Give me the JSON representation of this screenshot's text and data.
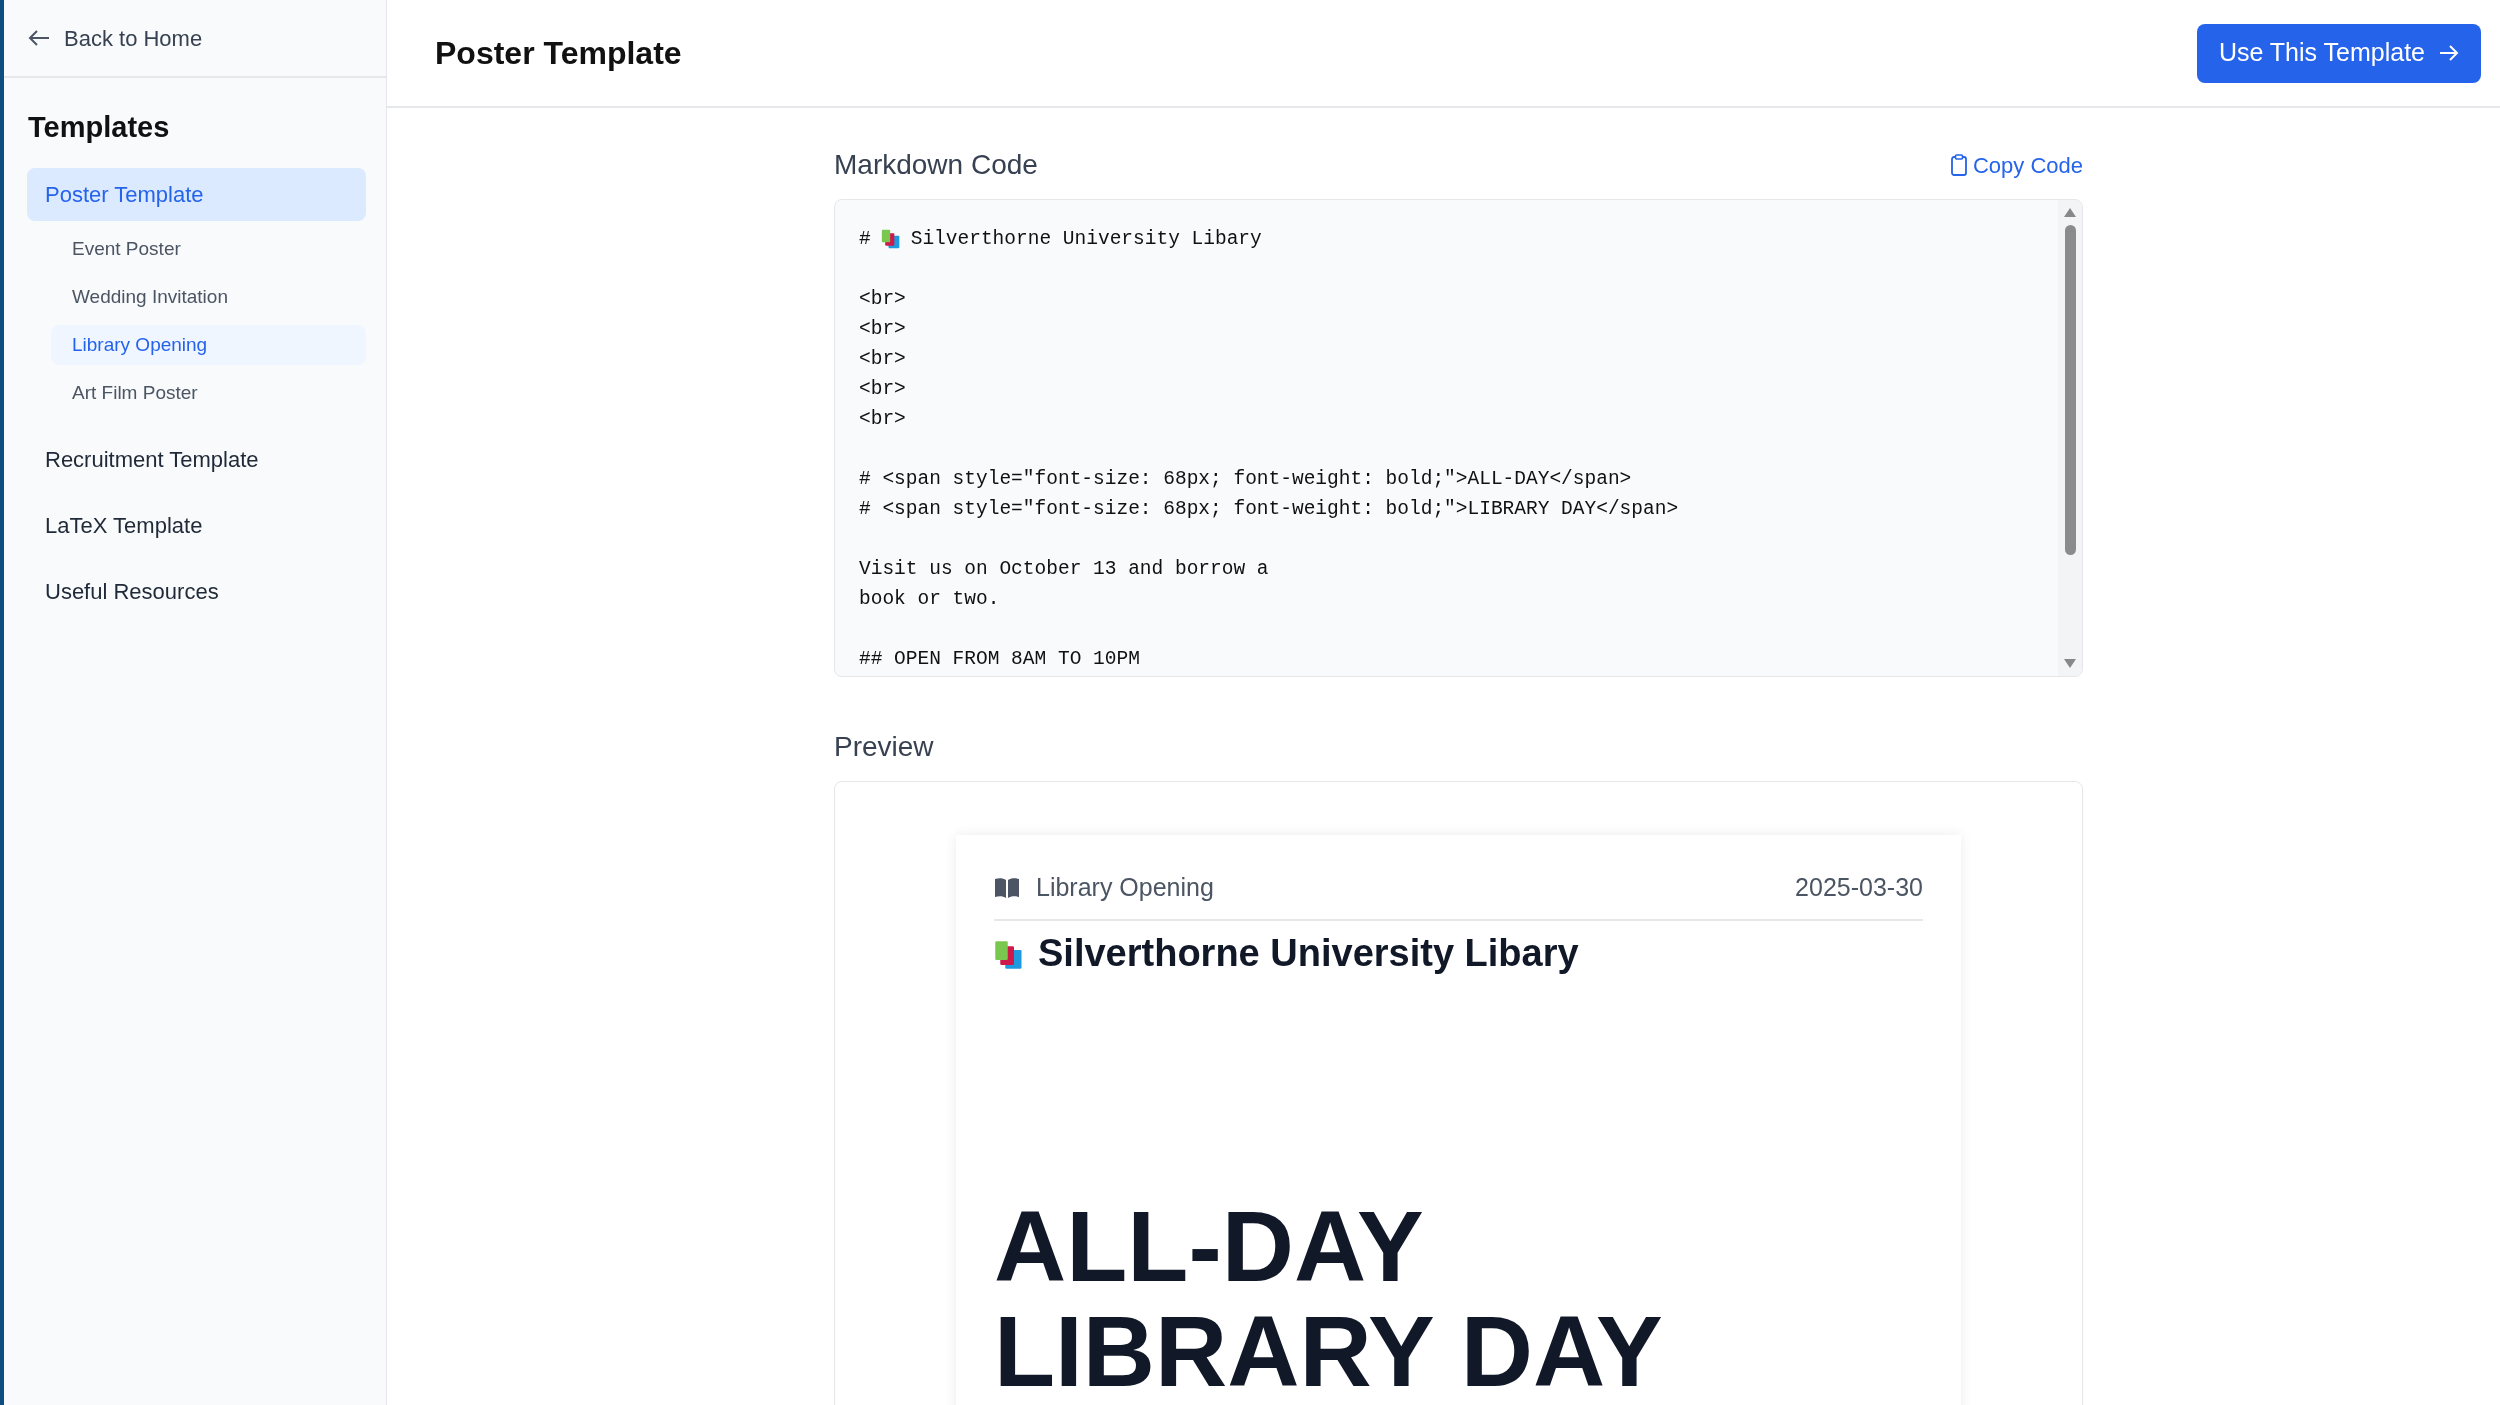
{
  "sidebar": {
    "back_link": "Back to Home",
    "heading": "Templates",
    "items": [
      {
        "label": "Poster Template",
        "selected": true,
        "children": [
          {
            "label": "Event Poster",
            "selected": false
          },
          {
            "label": "Wedding Invitation",
            "selected": false
          },
          {
            "label": "Library Opening",
            "selected": true
          },
          {
            "label": "Art Film Poster",
            "selected": false
          }
        ]
      },
      {
        "label": "Recruitment Template",
        "selected": false
      },
      {
        "label": "LaTeX Template",
        "selected": false
      },
      {
        "label": "Useful Resources",
        "selected": false
      }
    ]
  },
  "header": {
    "title": "Poster Template",
    "action_button": "Use This Template"
  },
  "code_section": {
    "title": "Markdown Code",
    "copy_button": "Copy Code",
    "lines": [
      {
        "kind": "icon-heading",
        "marker": "#",
        "text": "Silverthorne University Libary"
      },
      {
        "kind": "blank"
      },
      {
        "kind": "text",
        "text": "<br>"
      },
      {
        "kind": "text",
        "text": "<br>"
      },
      {
        "kind": "text",
        "text": "<br>"
      },
      {
        "kind": "text",
        "text": "<br>"
      },
      {
        "kind": "text",
        "text": "<br>"
      },
      {
        "kind": "blank"
      },
      {
        "kind": "text",
        "text": "# <span style=\"font-size: 68px; font-weight: bold;\">ALL-DAY</span>"
      },
      {
        "kind": "text",
        "text": "# <span style=\"font-size: 68px; font-weight: bold;\">LIBRARY DAY</span>"
      },
      {
        "kind": "blank"
      },
      {
        "kind": "text",
        "text": "Visit us on October 13 and borrow a"
      },
      {
        "kind": "text",
        "text": "book or two."
      },
      {
        "kind": "blank"
      },
      {
        "kind": "text",
        "text": "## OPEN FROM 8AM TO 10PM"
      }
    ]
  },
  "preview": {
    "title": "Preview",
    "category": "Library Opening",
    "date": "2025-03-30",
    "poster_title": "Silverthorne University Libary",
    "headline_lines": [
      "ALL-DAY",
      "LIBRARY DAY"
    ]
  }
}
